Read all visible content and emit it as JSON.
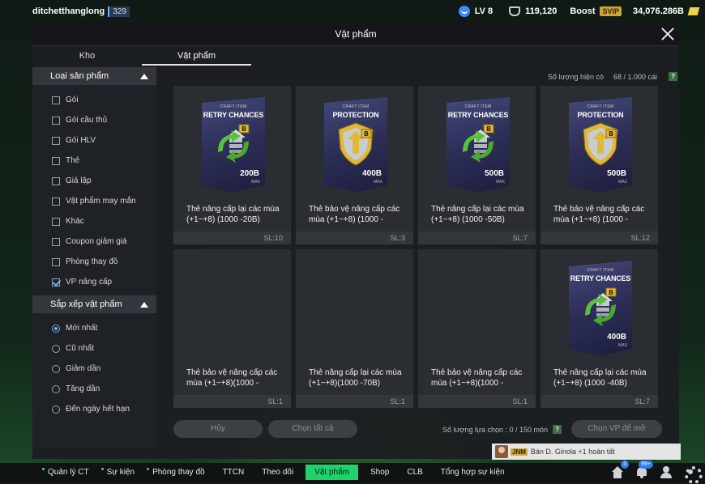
{
  "top": {
    "username": "ditchetthanglong",
    "user_id": "329",
    "level": "LV 8",
    "coins": "119,120",
    "boost_label": "Boost",
    "svip_label": "SVIP",
    "bp": "34,076.286B"
  },
  "modal": {
    "title": "Vật phẩm",
    "tabs": [
      "Kho",
      "Vật phẩm"
    ]
  },
  "sidebar": {
    "product_type_header": "Loại sản phẩm",
    "product_types": [
      "Gói",
      "Gói cầu thủ",
      "Gói HLV",
      "Thẻ",
      "Giả lập",
      "Vật phẩm may mắn",
      "Khác",
      "Coupon giảm giá",
      "Phòng thay đồ",
      "VP nâng cấp"
    ],
    "sort_header": "Sắp xếp vật phẩm",
    "sort_options": [
      "Mới nhất",
      "Cũ nhất",
      "Giảm dần",
      "Tăng dần",
      "Đến ngày hết hạn"
    ]
  },
  "inventory": {
    "label": "Số lượng hiện có",
    "value": "68 / 1.000 cái",
    "help": "?"
  },
  "items": [
    {
      "craft": "CRAFT ITEM",
      "type": "RETRY CHANCES",
      "value": "200B",
      "max": "MAX",
      "name": "Thẻ nâng cấp lại các mùa (+1~+8) (1000 -20B)",
      "qty": "SL:10",
      "visible": true
    },
    {
      "craft": "CRAFT ITEM",
      "type": "PROTECTION",
      "value": "400B",
      "max": "MAX",
      "name": "Thẻ bảo vệ nâng cấp các mùa (+1~+8) (1000 -",
      "qty": "SL:3",
      "visible": true
    },
    {
      "craft": "CRAFT ITEM",
      "type": "RETRY CHANCES",
      "value": "500B",
      "max": "MAX",
      "name": "Thẻ nâng cấp lại các mùa (+1~+8) (1000 -50B)",
      "qty": "SL:7",
      "visible": true
    },
    {
      "craft": "CRAFT ITEM",
      "type": "PROTECTION",
      "value": "500B",
      "max": "MAX",
      "name": "Thẻ bảo vệ nâng cấp các mùa (+1~+8) (1000 -",
      "qty": "SL:12",
      "visible": true
    },
    {
      "craft": "",
      "type": "",
      "value": "",
      "max": "",
      "name": "Thẻ bảo vệ nâng cấp các mùa (+1~+8)(1000 -",
      "qty": "SL:1",
      "visible": false
    },
    {
      "craft": "",
      "type": "",
      "value": "",
      "max": "",
      "name": "Thẻ nâng cấp lại các mùa (+1~+8)(1000 -70B)",
      "qty": "SL:1",
      "visible": false
    },
    {
      "craft": "",
      "type": "",
      "value": "",
      "max": "",
      "name": "Thẻ bảo vệ nâng cấp các mùa (+1~+8)(1000 -",
      "qty": "SL:1",
      "visible": false
    },
    {
      "craft": "CRAFT ITEM",
      "type": "RETRY CHANCES",
      "value": "400B",
      "max": "MAX",
      "name": "Thẻ nâng cấp lại các mùa (+1~+8) (1000 -40B)",
      "qty": "SL:7",
      "visible": true
    }
  ],
  "footer": {
    "cancel": "Hủy",
    "select_all": "Chọn tất cả",
    "selected_label": "Số lượng lựa chọn : 0 / 150 món",
    "help": "?",
    "open_selected": "Chọn VP để mở"
  },
  "notification": {
    "tag": "JNM",
    "text": "Bán D. Ginola +1 hoàn tất"
  },
  "nav": {
    "items": [
      "Quản lý CT",
      "Sự kiện",
      "Phòng thay đồ",
      "TTCN",
      "Theo dõi",
      "Vật phẩm",
      "Shop",
      "CLB",
      "Tổng hợp sự kiện"
    ],
    "badge_house": "3",
    "badge_bell": "99+"
  },
  "colors": {
    "accent_green": "#1fd36a",
    "accent_blue": "#6ab0ff",
    "retry_arrow": "#5ac23a",
    "protection_gold": "#e0b83a"
  }
}
